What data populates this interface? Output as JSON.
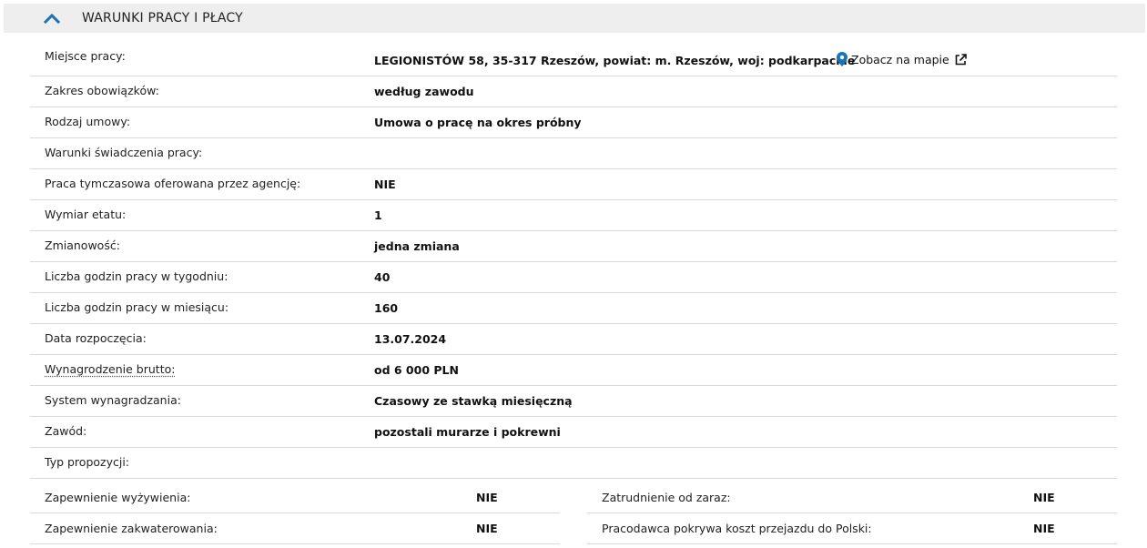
{
  "section": {
    "title": "WARUNKI PRACY I PŁACY",
    "toggle_icon": "chevron-up-icon",
    "accent_color": "#1a73b8"
  },
  "rows": [
    {
      "label": "Miejsce pracy:",
      "value": "LEGIONISTÓW 58, 35-317 Rzeszów, powiat: m. Rzeszów, woj: podkarpackie"
    },
    {
      "label": "Zakres obowiązków:",
      "value": "według zawodu"
    },
    {
      "label": "Rodzaj umowy:",
      "value": "Umowa o pracę na okres próbny"
    },
    {
      "label": "Warunki świadczenia pracy:",
      "value": ""
    },
    {
      "label": "Praca tymczasowa oferowana przez agencję:",
      "value": "NIE"
    },
    {
      "label": "Wymiar etatu:",
      "value": "1"
    },
    {
      "label": "Zmianowość:",
      "value": "jedna zmiana"
    },
    {
      "label": "Liczba godzin pracy w tygodniu:",
      "value": "40"
    },
    {
      "label": "Liczba godzin pracy w miesiącu:",
      "value": "160"
    },
    {
      "label": "Data rozpoczęcia:",
      "value": "13.07.2024"
    },
    {
      "label": "Wynagrodzenie brutto:",
      "value": "od 6 000 PLN"
    },
    {
      "label": "System wynagradzania:",
      "value": "Czasowy ze stawką miesięczną"
    },
    {
      "label": "Zawód:",
      "value": "pozostali murarze i pokrewni"
    },
    {
      "label": "Typ propozycji:",
      "value": ""
    }
  ],
  "map_link": {
    "label": "Zobacz na mapie",
    "pin_icon": "map-pin-icon",
    "external_icon": "external-link-icon",
    "pin_color": "#1a73b8"
  },
  "half_rows": [
    {
      "left_label": "Zapewnienie wyżywienia:",
      "left_value": "NIE",
      "right_label": "Zatrudnienie od zaraz:",
      "right_value": "NIE"
    },
    {
      "left_label": "Zapewnienie zakwaterowania:",
      "left_value": "NIE",
      "right_label": "Pracodawca pokrywa koszt przejazdu do Polski:",
      "right_value": "NIE"
    }
  ]
}
